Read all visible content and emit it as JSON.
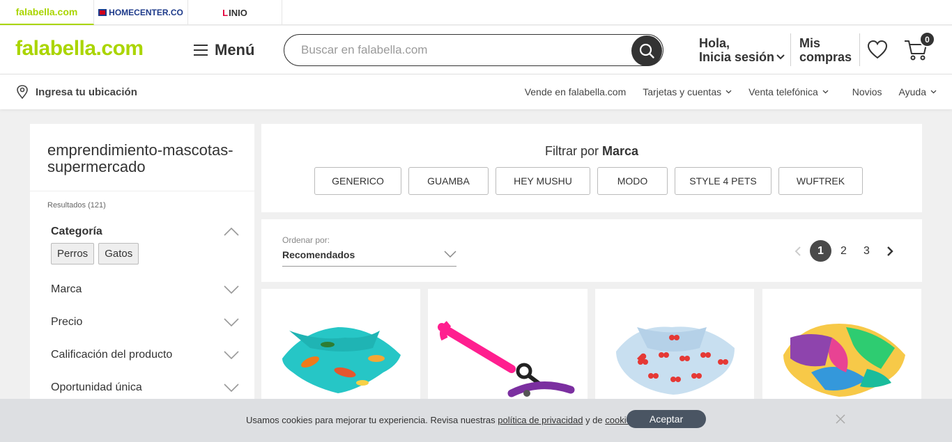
{
  "brand_tabs": {
    "falabella": "falabella.com",
    "homecenter": "HOMECENTER.CO",
    "linio_mark": "L",
    "linio": "INIO"
  },
  "header": {
    "logo": "falabella.com",
    "menu_label": "Menú",
    "search_placeholder": "Buscar en falabella.com",
    "greeting_line1": "Hola,",
    "greeting_line2": "Inicia sesión",
    "orders_line1": "Mis",
    "orders_line2": "compras",
    "cart_count": "0"
  },
  "location_bar": {
    "location_label": "Ingresa tu ubicación",
    "links": [
      "Vende en falabella.com",
      "Tarjetas y cuentas",
      "Venta telefónica",
      "Novios",
      "Ayuda"
    ]
  },
  "sidebar": {
    "title": "emprendimiento-mascotas-supermercado",
    "results": "Resultados (121)",
    "category_label": "Categoría",
    "category_chips": [
      "Perros",
      "Gatos"
    ],
    "facets": [
      "Marca",
      "Precio",
      "Calificación del producto",
      "Oportunidad única"
    ]
  },
  "brand_filter": {
    "title_prefix": "Filtrar por",
    "title_bold": "Marca",
    "brands": [
      "GENERICO",
      "GUAMBA",
      "HEY MUSHU",
      "MODO",
      "STYLE 4 PETS",
      "WUFTREK"
    ]
  },
  "sort": {
    "label": "Ordenar por:",
    "value": "Recomendados"
  },
  "pagination": {
    "pages": [
      "1",
      "2",
      "3"
    ],
    "current": "1"
  },
  "products": [
    {
      "image": "turquoise-dinosaur-bandana"
    },
    {
      "image": "pink-purple-leash"
    },
    {
      "image": "light-blue-hearts-bandana"
    },
    {
      "image": "multicolor-abstract-bandana"
    }
  ],
  "cookie_banner": {
    "text_before": "Usamos cookies para mejorar tu experiencia. Revisa nuestras",
    "privacy_link": "política de privacidad",
    "text_middle": "y de",
    "cookies_link": "cookies",
    "text_end": ".",
    "accept_label": "Aceptar"
  },
  "colors": {
    "falabella_green": "#aad500",
    "dark": "#333333",
    "banner_button": "#4a5563"
  }
}
